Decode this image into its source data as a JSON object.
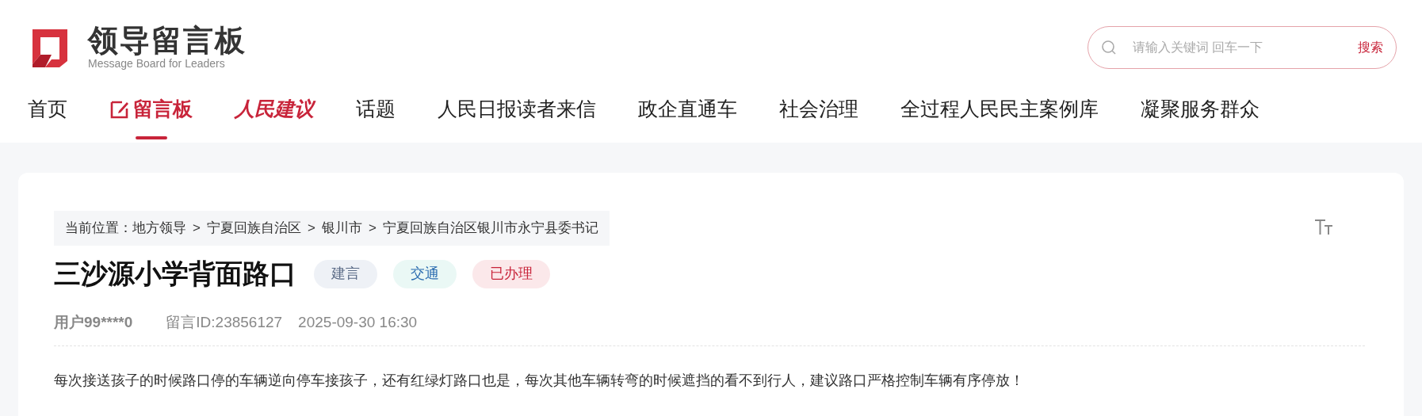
{
  "logo": {
    "title": "领导留言板",
    "subtitle": "Message Board for Leaders"
  },
  "search": {
    "placeholder": "请输入关键词 回车一下",
    "button": "搜索"
  },
  "nav": [
    {
      "label": "首页",
      "kind": "plain",
      "selected": false
    },
    {
      "label": "留言板",
      "kind": "icon",
      "selected": true
    },
    {
      "label": "人民建议",
      "kind": "brand",
      "selected": false
    },
    {
      "label": "话题",
      "kind": "plain",
      "selected": false
    },
    {
      "label": "人民日报读者来信",
      "kind": "plain",
      "selected": false
    },
    {
      "label": "政企直通车",
      "kind": "plain",
      "selected": false
    },
    {
      "label": "社会治理",
      "kind": "plain",
      "selected": false
    },
    {
      "label": "全过程人民民主案例库",
      "kind": "plain",
      "selected": false
    },
    {
      "label": "凝聚服务群众",
      "kind": "plain",
      "selected": false
    }
  ],
  "breadcrumb": {
    "label": "当前位置：",
    "items": [
      "地方领导",
      "宁夏回族自治区",
      "银川市",
      "宁夏回族自治区银川市永宁县委书记"
    ],
    "separator": ">"
  },
  "message": {
    "title": "三沙源小学背面路口",
    "tags": [
      {
        "label": "建言",
        "color": "#eef1f6"
      },
      {
        "label": "交通",
        "color": "#eaf8f5"
      },
      {
        "label": "已办理",
        "color": "#fbe8ea"
      }
    ],
    "user": "用户99****0",
    "id": "留言ID:23856127",
    "time": "2025-09-30 16:30",
    "body": "每次接送孩子的时候路口停的车辆逆向停车接孩子，还有红绿灯路口也是，每次其他车辆转弯的时候遮挡的看不到行人，建议路口严格控制车辆有序停放！"
  }
}
